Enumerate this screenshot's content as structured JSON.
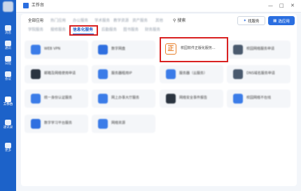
{
  "window": {
    "title": "工作台",
    "minimize": "—",
    "maximize": "□",
    "close": "✕"
  },
  "sidebar": {
    "items": [
      {
        "label": "消息",
        "icon": "message-icon"
      },
      {
        "label": "通讯",
        "icon": "contacts-icon"
      },
      {
        "label": "日程",
        "icon": "calendar-icon"
      },
      {
        "label": "会议",
        "icon": "meeting-icon"
      },
      {
        "label": "工作台",
        "icon": "workbench-icon",
        "active": true
      },
      {
        "label": "通讯录",
        "icon": "address-book-icon"
      },
      {
        "label": "更多",
        "icon": "more-icon"
      }
    ]
  },
  "tabs_row1": [
    {
      "label": "全部应用"
    },
    {
      "label": "热门应用"
    },
    {
      "label": "办公服务"
    },
    {
      "label": "学术服务"
    },
    {
      "label": "教学资源"
    },
    {
      "label": "资产服务"
    },
    {
      "label": "其他"
    }
  ],
  "tabs_row2": [
    {
      "label": "学院服务"
    },
    {
      "label": "报修服务"
    },
    {
      "label": "信息化服务",
      "active": true
    },
    {
      "label": "后勤服务"
    },
    {
      "label": "图书服务"
    },
    {
      "label": "财务服务"
    }
  ],
  "search": {
    "label": "搜索"
  },
  "buttons": {
    "find_service": "找服务",
    "pick_app": "选应用"
  },
  "cards": [
    {
      "label": "WEB VPN",
      "color": "#3b7ce8"
    },
    {
      "label": "数字网盘",
      "color": "#2f6fe0"
    },
    {
      "label": "校园软件正版化服务...",
      "color": "#e8802a",
      "highlighted": true
    },
    {
      "label": "校园网络服务申请",
      "color": "#4a5a6e"
    },
    {
      "label": "邮箱及网络使用申请",
      "color": "#2b3440"
    },
    {
      "label": "服务器租用IP",
      "color": "#3b7ce8"
    },
    {
      "label": "服务器（云服务）",
      "color": "#3b7ce8"
    },
    {
      "label": "DNS域名服务申请",
      "color": "#4a5a6e"
    },
    {
      "label": "统一身份认证服务",
      "color": "#3b7ce8"
    },
    {
      "label": "网上办事大厅服务",
      "color": "#3b7ce8"
    },
    {
      "label": "网络安全事件报告",
      "color": "#2b3440"
    },
    {
      "label": "校园网络不在线",
      "color": "#3b7ce8"
    },
    {
      "label": "数字学习平台服务",
      "color": "#2f6fe0"
    },
    {
      "label": "网络资源",
      "color": "#3b7ce8"
    }
  ]
}
